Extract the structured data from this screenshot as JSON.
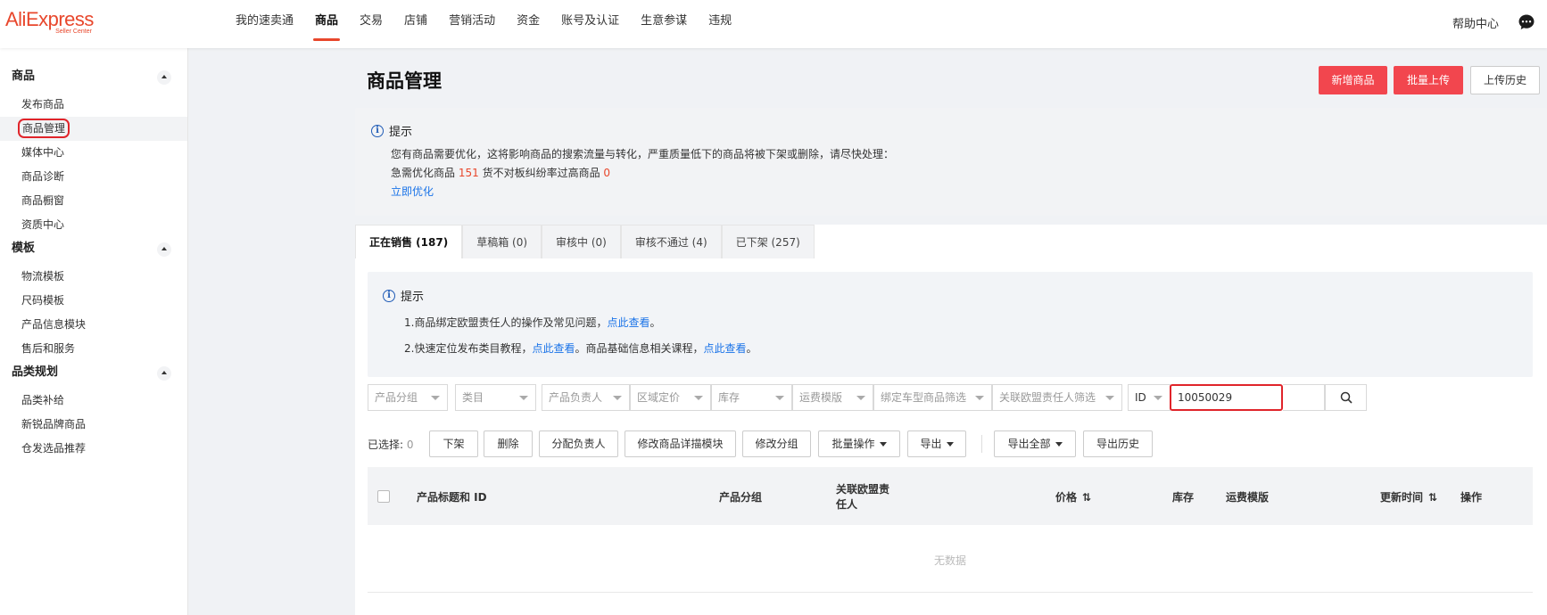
{
  "logo": {
    "brand": "AliExpress",
    "sub": "Seller Center"
  },
  "nav": [
    "我的速卖通",
    "商品",
    "交易",
    "店铺",
    "营销活动",
    "资金",
    "账号及认证",
    "生意参谋",
    "违规"
  ],
  "header": {
    "help": "帮助中心",
    "chat_icon": "chat-bubble-icon"
  },
  "sidebar": {
    "groups": [
      {
        "title": "商品",
        "items": [
          "发布商品",
          "商品管理",
          "媒体中心",
          "商品诊断",
          "商品橱窗",
          "资质中心"
        ]
      },
      {
        "title": "模板",
        "items": [
          "物流模板",
          "尺码模板",
          "产品信息模块",
          "售后和服务"
        ]
      },
      {
        "title": "品类规划",
        "items": [
          "品类补给",
          "新锐品牌商品",
          "仓发选品推荐"
        ]
      }
    ],
    "active_item": "商品管理"
  },
  "page": {
    "title": "商品管理",
    "buttons": {
      "add": "新增商品",
      "batch_upload": "批量上传",
      "upload_history": "上传历史"
    }
  },
  "tip1": {
    "title": "提示",
    "line1": "您有商品需要优化，这将影响商品的搜索流量与转化，严重质量低下的商品将被下架或删除，请尽快处理：",
    "pending_label": "急需优化商品",
    "pending_count": "151",
    "mismatch_label": "货不对板纠纷率过高商品",
    "mismatch_count": "0",
    "action": "立即优化"
  },
  "tabs": [
    "正在销售 (187)",
    "草稿箱 (0)",
    "审核中 (0)",
    "审核不通过 (4)",
    "已下架 (257)"
  ],
  "tip2": {
    "title": "提示",
    "line1_text": "1.商品绑定欧盟责任人的操作及常见问题，",
    "line1_link": "点此查看",
    "line1_end": "。",
    "line2_text": "2.快速定位发布类目教程，",
    "line2_link": "点此查看",
    "line2_mid": "。商品基础信息相关课程，",
    "line2_link2": "点此查看",
    "line2_end": "。"
  },
  "filters": [
    "产品分组",
    "类目",
    "产品负责人",
    "区域定价",
    "库存",
    "运费模版",
    "绑定车型商品筛选",
    "关联欧盟责任人筛选"
  ],
  "id_filter": {
    "type": "ID",
    "value": "10050029"
  },
  "actions": {
    "selected_label": "已选择:",
    "selected_count": "0",
    "buttons": [
      "下架",
      "删除",
      "分配负责人",
      "修改商品详描模块",
      "修改分组",
      "批量操作",
      "导出",
      "导出全部",
      "导出历史"
    ]
  },
  "table": {
    "headers": {
      "title": "产品标题和 ID",
      "group": "产品分组",
      "eu_line1": "关联欧盟责",
      "eu_line2": "任人",
      "price": "价格",
      "stock": "库存",
      "shipping": "运费模版",
      "updated": "更新时间",
      "ops": "操作"
    },
    "empty": "无数据"
  }
}
